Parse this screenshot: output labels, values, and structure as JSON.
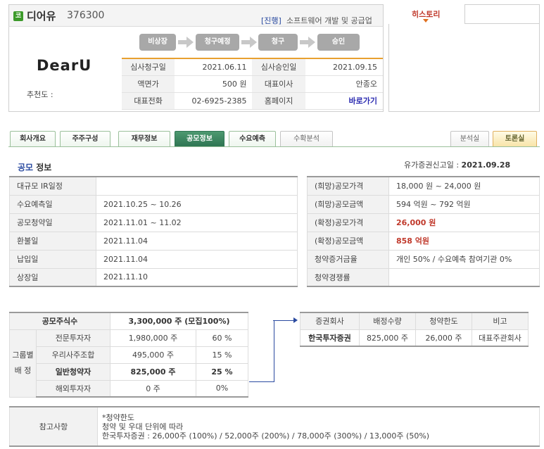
{
  "header": {
    "market_icon": "코",
    "company_name": "디어유",
    "company_code": "376300",
    "status_tag": "[진행]",
    "industry": "소프트웨어 개발 및 공급업",
    "logo_text": "DearU",
    "recommend_label": "추천도 :"
  },
  "steps": [
    "비상장",
    "청구예정",
    "청구",
    "승인"
  ],
  "info": {
    "rows": [
      {
        "l1": "심사청구일",
        "v1": "2021.06.11",
        "l2": "심사승인일",
        "v2": "2021.09.15"
      },
      {
        "l1": "액면가",
        "v1": "500 원",
        "l2": "대표이사",
        "v2": "안종오"
      },
      {
        "l1": "대표전화",
        "v1": "02-6925-2385",
        "l2": "홈페이지",
        "v2": "바로가기"
      }
    ]
  },
  "history": {
    "label": "히스토리"
  },
  "tabs": {
    "items": [
      "회사개요",
      "주주구성",
      "재무정보",
      "공모정보",
      "수요예측",
      "수확분석"
    ],
    "right": [
      "분석실",
      "토론실"
    ]
  },
  "offering": {
    "title_hl": "공모",
    "title_rest": " 정보",
    "filing_label": "유가증권신고일 : ",
    "filing_date": "2021.09.28",
    "schedule": [
      {
        "label": "대규모 IR일정",
        "value": ""
      },
      {
        "label": "수요예측일",
        "value": "2021.10.25 ~ 10.26"
      },
      {
        "label": "공모청약일",
        "value": "2021.11.01 ~ 11.02"
      },
      {
        "label": "환불일",
        "value": "2021.11.04"
      },
      {
        "label": "납입일",
        "value": "2021.11.04"
      },
      {
        "label": "상장일",
        "value": "2021.11.10"
      }
    ],
    "prices": [
      {
        "label": "(희망)공모가격",
        "value": "18,000 원 ~ 24,000 원"
      },
      {
        "label": "(희망)공모금액",
        "value": "594 억원  ~ 792 억원"
      },
      {
        "label": "(확정)공모가격",
        "value": "26,000 원"
      },
      {
        "label": "(확정)공모금액",
        "value": "858 억원"
      },
      {
        "label": "청약증거금율",
        "value": "개인 50% / 수요예측 참여기관 0%"
      },
      {
        "label": "청약경쟁률",
        "value": ""
      }
    ]
  },
  "allocation": {
    "total_label": "공모주식수",
    "total_value": "3,300,000 주 (모집100%)",
    "group_label_1": "그룹별",
    "group_label_2": "배  정",
    "rows": [
      {
        "label": "전문투자자",
        "shares": "1,980,000 주",
        "pct": "60 %"
      },
      {
        "label": "우리사주조합",
        "shares": "495,000 주",
        "pct": "15 %"
      },
      {
        "label": "일반청약자",
        "shares": "825,000 주",
        "pct": "25 %"
      },
      {
        "label": "해외투자자",
        "shares": "0 주",
        "pct": "0%"
      }
    ]
  },
  "broker": {
    "headers": [
      "증권회사",
      "배정수량",
      "청약한도",
      "비고"
    ],
    "row": {
      "name": "한국투자증권",
      "qty": "825,000 주",
      "limit": "26,000 주",
      "note": "대표주관회사"
    }
  },
  "note": {
    "label": "참고사항",
    "lines": [
      "*청약한도",
      "청약 및 우대 단위에 따라",
      "한국투자증권 : 26,000주 (100%) / 52,000주 (200%) / 78,000주 (300%) / 13,000주 (50%)"
    ]
  }
}
